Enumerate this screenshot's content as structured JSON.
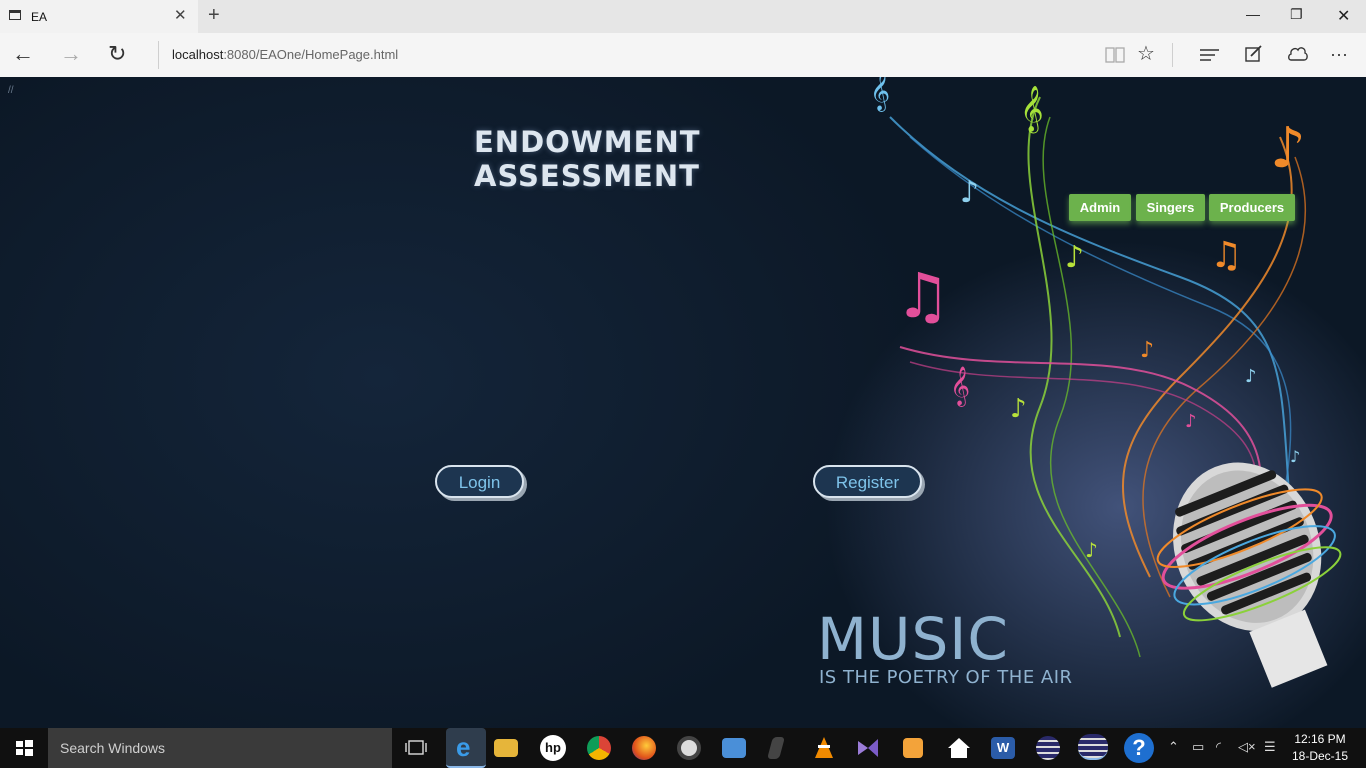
{
  "browser": {
    "tab_title": "EA",
    "url_host": "localhost",
    "url_rest": ":8080/EAOne/HomePage.html"
  },
  "page": {
    "title": "ENDOWMENT ASSESSMENT",
    "corner_mark": "//",
    "nav_buttons": [
      "Admin",
      "Singers",
      "Producers"
    ],
    "login_label": "Login",
    "register_label": "Register",
    "music_word": "MUSIC",
    "music_sub": "IS THE POETRY OF THE AIR"
  },
  "taskbar": {
    "search_placeholder": "Search Windows",
    "time": "12:16 PM",
    "date": "18-Dec-15"
  },
  "colors": {
    "accent_green": "#6cb24c",
    "page_bg": "#0f1c2b",
    "title_text": "#dde6ef"
  },
  "icons": [
    "window-icon",
    "close-icon",
    "plus-icon",
    "minimize-icon",
    "restore-icon",
    "back-icon",
    "forward-icon",
    "refresh-icon",
    "reading-view-icon",
    "favorite-star-icon",
    "hub-icon",
    "web-note-icon",
    "share-icon",
    "more-icon",
    "windows-logo-icon",
    "task-view-icon",
    "edge-icon",
    "file-explorer-icon",
    "hp-icon",
    "chrome-icon",
    "firefox-icon",
    "media-icon",
    "help-icon"
  ]
}
